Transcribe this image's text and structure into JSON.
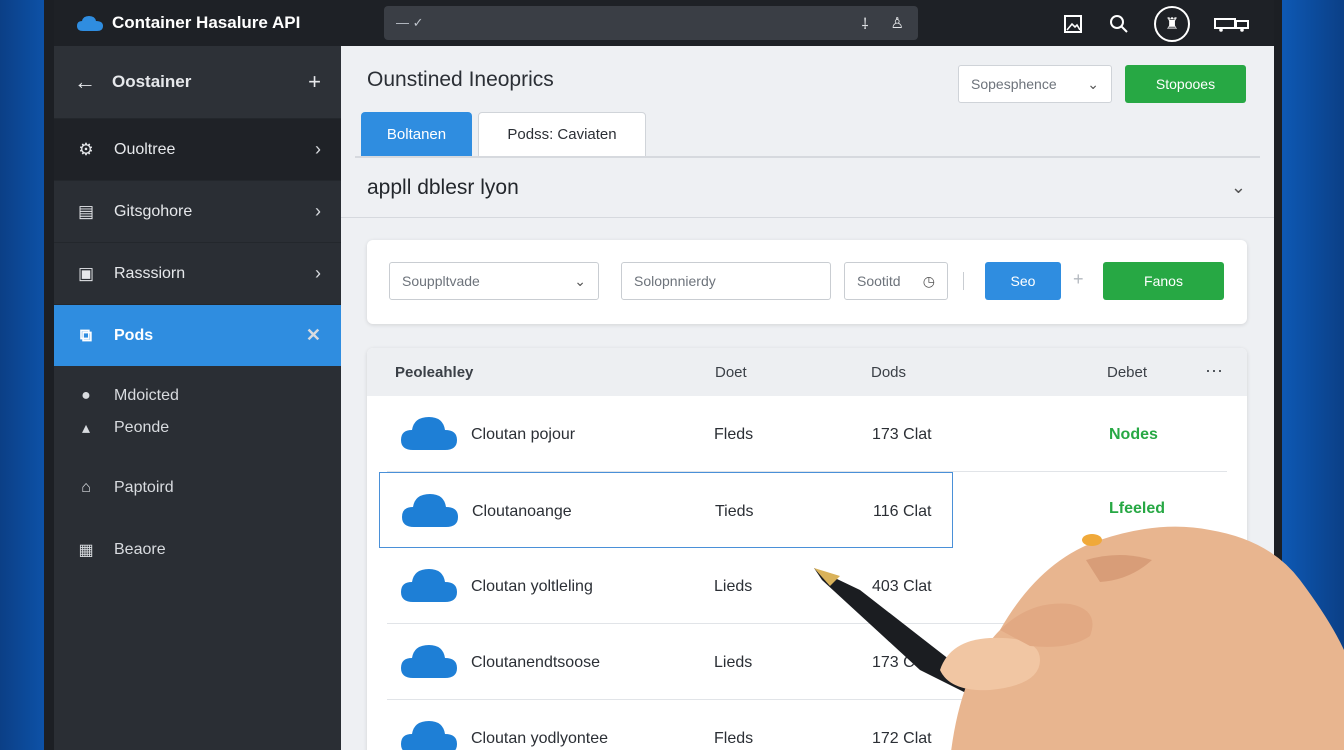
{
  "app": {
    "title": "Container Hasalure API",
    "search_left": "— ✓",
    "colors": {
      "accent_blue": "#2f8de0",
      "accent_green": "#27a844",
      "sidebar": "#2a2e34",
      "topbar": "#1e2126"
    }
  },
  "sidebar": {
    "header": "Oostainer",
    "items": [
      {
        "label": "Ouoltree",
        "icon": "gear-icon"
      },
      {
        "label": "Gitsgohore",
        "icon": "folder-icon"
      },
      {
        "label": "Rasssiorn",
        "icon": "box-icon"
      },
      {
        "label": "Pods",
        "icon": "pods-icon"
      }
    ],
    "subitems": [
      {
        "label": "Mdoicted",
        "icon": "pin-icon"
      },
      {
        "label": "Peonde",
        "icon": "bell-icon"
      },
      {
        "label": "Paptoird",
        "icon": "home-icon"
      },
      {
        "label": "Beaore",
        "icon": "grid-icon"
      }
    ]
  },
  "main": {
    "title": "Ounstined Ineoprics",
    "top_select": "Sopesphence",
    "top_button": "Stopooes",
    "tabs": [
      "Boltanen",
      "Podss: Caviaten"
    ],
    "section_title": "appll dblesr lyon",
    "filters": {
      "select": "Souppltvade",
      "search": "Solopnnierdy",
      "small": "Sootitd",
      "blue_button": "Seo",
      "green_button": "Fanos"
    }
  },
  "table": {
    "headers": [
      "Peoleahley",
      "Doet",
      "Dods",
      "Debet"
    ],
    "rows": [
      {
        "name": "Cloutan pojour",
        "type": "Fleds",
        "count": "173 Clat",
        "status": "Nodes"
      },
      {
        "name": "Cloutanoange",
        "type": "Tieds",
        "count": "116 Clat",
        "status": "Lfeeled"
      },
      {
        "name": "Cloutan yoltleling",
        "type": "Lieds",
        "count": "403 Clat",
        "status": ""
      },
      {
        "name": "Cloutanendtsoose",
        "type": "Lieds",
        "count": "173 C",
        "status": ""
      },
      {
        "name": "Cloutan yodlyontee",
        "type": "Fleds",
        "count": "172 Clat",
        "status": ""
      }
    ]
  }
}
